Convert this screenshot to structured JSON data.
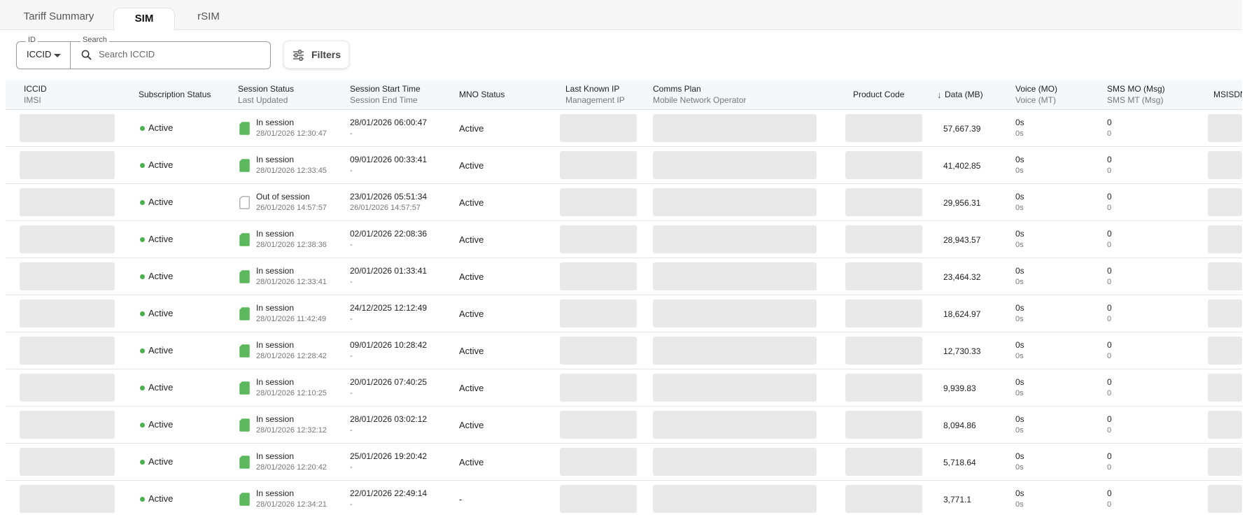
{
  "tabs": [
    {
      "label": "Tariff Summary",
      "active": false
    },
    {
      "label": "SIM",
      "active": true
    },
    {
      "label": "rSIM",
      "active": false
    }
  ],
  "search": {
    "id_label": "ID",
    "id_value": "ICCID",
    "search_label": "Search",
    "placeholder": "Search ICCID"
  },
  "filters": {
    "label": "Filters"
  },
  "colors": {
    "active_dot": "#4caf50",
    "sim_in_session": "#5cb85c",
    "header_bg": "#f4f8fb"
  },
  "table": {
    "headers": {
      "iccid": {
        "line1": "ICCID",
        "line2": "IMSI"
      },
      "subscription": {
        "line1": "Subscription Status",
        "line2": ""
      },
      "session": {
        "line1": "Session Status",
        "line2": "Last Updated"
      },
      "start": {
        "line1": "Session Start Time",
        "line2": "Session End Time"
      },
      "mno": {
        "line1": "MNO Status",
        "line2": ""
      },
      "ip": {
        "line1": "Last Known IP",
        "line2": "Management IP"
      },
      "plan": {
        "line1": "Comms Plan",
        "line2": "Mobile Network Operator"
      },
      "product": {
        "line1": "Product Code",
        "line2": ""
      },
      "data": {
        "line1": "Data (MB)",
        "line2": ""
      },
      "voice": {
        "line1": "Voice (MO)",
        "line2": "Voice (MT)"
      },
      "sms": {
        "line1": "SMS MO (Msg)",
        "line2": "SMS MT (Msg)"
      },
      "msisdn": {
        "line1": "MSISDN",
        "line2": ""
      }
    },
    "rows": [
      {
        "subscription": "Active",
        "session": "In session",
        "in_session": true,
        "updated": "28/01/2026 12:30:47",
        "start": "28/01/2026 06:00:47",
        "end": "-",
        "mno": "Active",
        "data": "57,667.39",
        "voice_mo": "0s",
        "voice_mt": "0s",
        "sms_mo": "0",
        "sms_mt": "0"
      },
      {
        "subscription": "Active",
        "session": "In session",
        "in_session": true,
        "updated": "28/01/2026 12:33:45",
        "start": "09/01/2026 00:33:41",
        "end": "-",
        "mno": "Active",
        "data": "41,402.85",
        "voice_mo": "0s",
        "voice_mt": "0s",
        "sms_mo": "0",
        "sms_mt": "0"
      },
      {
        "subscription": "Active",
        "session": "Out of session",
        "in_session": false,
        "updated": "26/01/2026 14:57:57",
        "start": "23/01/2026 05:51:34",
        "end": "26/01/2026 14:57:57",
        "mno": "Active",
        "data": "29,956.31",
        "voice_mo": "0s",
        "voice_mt": "0s",
        "sms_mo": "0",
        "sms_mt": "0"
      },
      {
        "subscription": "Active",
        "session": "In session",
        "in_session": true,
        "updated": "28/01/2026 12:38:36",
        "start": "02/01/2026 22:08:36",
        "end": "-",
        "mno": "Active",
        "data": "28,943.57",
        "voice_mo": "0s",
        "voice_mt": "0s",
        "sms_mo": "0",
        "sms_mt": "0"
      },
      {
        "subscription": "Active",
        "session": "In session",
        "in_session": true,
        "updated": "28/01/2026 12:33:41",
        "start": "20/01/2026 01:33:41",
        "end": "-",
        "mno": "Active",
        "data": "23,464.32",
        "voice_mo": "0s",
        "voice_mt": "0s",
        "sms_mo": "0",
        "sms_mt": "0"
      },
      {
        "subscription": "Active",
        "session": "In session",
        "in_session": true,
        "updated": "28/01/2026 11:42:49",
        "start": "24/12/2025 12:12:49",
        "end": "-",
        "mno": "Active",
        "data": "18,624.97",
        "voice_mo": "0s",
        "voice_mt": "0s",
        "sms_mo": "0",
        "sms_mt": "0"
      },
      {
        "subscription": "Active",
        "session": "In session",
        "in_session": true,
        "updated": "28/01/2026 12:28:42",
        "start": "09/01/2026 10:28:42",
        "end": "-",
        "mno": "Active",
        "data": "12,730.33",
        "voice_mo": "0s",
        "voice_mt": "0s",
        "sms_mo": "0",
        "sms_mt": "0"
      },
      {
        "subscription": "Active",
        "session": "In session",
        "in_session": true,
        "updated": "28/01/2026 12:10:25",
        "start": "20/01/2026 07:40:25",
        "end": "-",
        "mno": "Active",
        "data": "9,939.83",
        "voice_mo": "0s",
        "voice_mt": "0s",
        "sms_mo": "0",
        "sms_mt": "0"
      },
      {
        "subscription": "Active",
        "session": "In session",
        "in_session": true,
        "updated": "28/01/2026 12:32:12",
        "start": "28/01/2026 03:02:12",
        "end": "-",
        "mno": "Active",
        "data": "8,094.86",
        "voice_mo": "0s",
        "voice_mt": "0s",
        "sms_mo": "0",
        "sms_mt": "0"
      },
      {
        "subscription": "Active",
        "session": "In session",
        "in_session": true,
        "updated": "28/01/2026 12:20:42",
        "start": "25/01/2026 19:20:42",
        "end": "-",
        "mno": "Active",
        "data": "5,718.64",
        "voice_mo": "0s",
        "voice_mt": "0s",
        "sms_mo": "0",
        "sms_mt": "0"
      },
      {
        "subscription": "Active",
        "session": "In session",
        "in_session": true,
        "updated": "28/01/2026 12:34:21",
        "start": "22/01/2026 22:49:14",
        "end": "-",
        "mno": "-",
        "data": "3,771.1",
        "voice_mo": "0s",
        "voice_mt": "0s",
        "sms_mo": "0",
        "sms_mt": "0"
      }
    ]
  }
}
